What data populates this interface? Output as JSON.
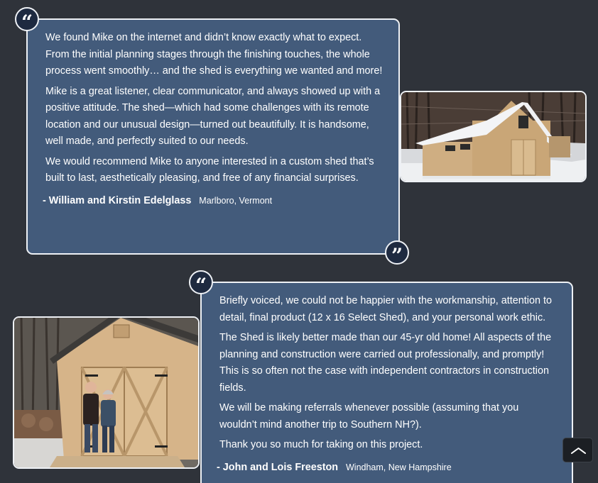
{
  "testimonials": [
    {
      "paragraphs": [
        "We found Mike on the internet and didn’t know exactly what to expect. From the initial planning stages through the finishing touches, the whole process went smoothly… and the shed is everything we wanted and more!",
        "Mike is a great listener, clear communicator, and always showed up with a positive attitude. The shed—which had some challenges with its remote location and our unusual design—turned out beautifully. It is handsome, well made, and perfectly suited to our needs.",
        "We would recommend Mike to anyone interested in a custom shed that’s built to last, aesthetically pleasing, and free of any financial surprises."
      ],
      "author": "- William and Kirstin Edelglass",
      "location": "Marlboro, Vermont",
      "photo_icon": "snowy-shed-photo"
    },
    {
      "paragraphs": [
        "Briefly voiced, we could not be happier with the workmanship, attention to detail, final product (12 x 16 Select Shed), and your personal work ethic.",
        "The Shed is likely better made than our 45-yr old home! All aspects of the planning and construction were carried out professionally, and promptly! This is so often not the case with independent contractors in construction fields.",
        "We will be making referrals whenever possible (assuming that you wouldn’t mind another trip to Southern NH?).",
        "Thank you so much for taking on this project."
      ],
      "author": "- John and Lois Freeston",
      "location": "Windham, New Hampshire",
      "photo_icon": "couple-with-shed-photo"
    }
  ],
  "quote_glyphs": {
    "open": "“",
    "close": "”"
  },
  "colors": {
    "page_background": "#2f333a",
    "card_background": "#435b7b",
    "card_border": "#eef1f5",
    "quote_badge": "#1e2a40",
    "back_to_top": "#1c1f24"
  },
  "back_to_top_icon": "chevron-up-icon"
}
